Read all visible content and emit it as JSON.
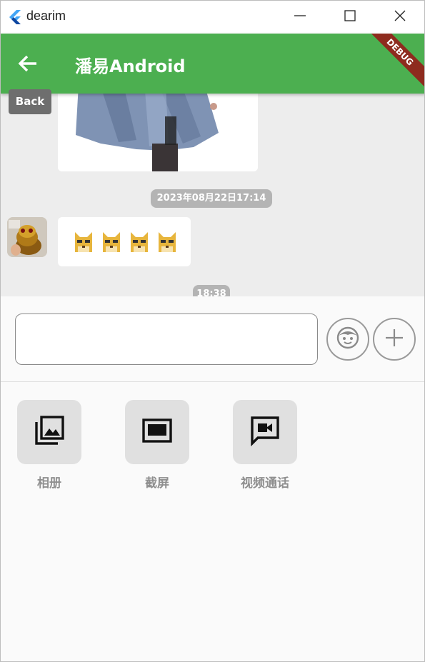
{
  "window": {
    "title": "dearim",
    "logo_icon": "flutter-logo-icon",
    "controls": {
      "minimize_icon": "minimize-icon",
      "maximize_icon": "maximize-icon",
      "close_icon": "close-icon"
    }
  },
  "appbar": {
    "title": "潘易Android",
    "back_icon": "arrow-back-icon",
    "back_tooltip": "Back",
    "debug_banner": "DEBUG",
    "color": "#4caf50"
  },
  "messages": {
    "items": [
      {
        "type": "image",
        "image": "photo-thumbnail"
      },
      {
        "type": "timestamp",
        "text": "2023年08月22日17:14"
      },
      {
        "type": "emoji",
        "avatar": "golden-figurine-avatar",
        "emoji": [
          "doge-icon",
          "doge-icon",
          "doge-icon",
          "doge-icon"
        ]
      },
      {
        "type": "timestamp",
        "text": "18:38"
      }
    ]
  },
  "input": {
    "value": "",
    "placeholder": "",
    "emoji_button_icon": "emoji-face-icon",
    "plus_button_icon": "plus-icon"
  },
  "tools": [
    {
      "label": "相册",
      "icon": "photo-library-icon"
    },
    {
      "label": "截屏",
      "icon": "screenshot-icon"
    },
    {
      "label": "视频通话",
      "icon": "video-chat-icon"
    }
  ]
}
